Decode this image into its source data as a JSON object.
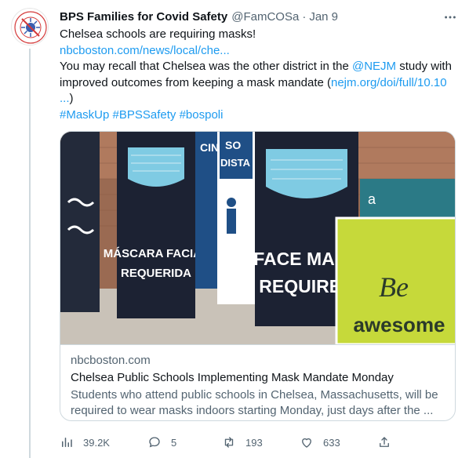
{
  "tweet": {
    "author_name": "BPS Families for Covid Safety",
    "handle": "@FamCOSa",
    "separator": "·",
    "time": "Jan 9",
    "avatar_alt": "FamCOSa logo",
    "lines": {
      "l1": "Chelsea schools are requiring masks!",
      "l2": "nbcboston.com/news/local/che...",
      "l3a": "You may recall that Chelsea was the other district in the ",
      "l3b": "@NEJM",
      "l3c": " study with improved outcomes from keeping a mask mandate (",
      "l3d": "nejm.org/doi/full/10.10 ...",
      "l3e": ")",
      "l4": "#MaskUp #BPSSafety #bospoli"
    }
  },
  "card": {
    "domain": "nbcboston.com",
    "title": "Chelsea Public Schools Implementing Mask Mandate Monday",
    "description": "Students who attend public schools in Chelsea, Massachusetts, will be required to wear masks indoors starting Monday, just days after the ..."
  },
  "image_text": {
    "sign_left_1": "MÁSCARA FACIAL",
    "sign_left_2": "REQUERIDA",
    "sign_main_1": "FACE MASK",
    "sign_main_2": "REQUIRED",
    "sign_right_1": "Be",
    "sign_right_2": "awesome",
    "sign_distance_1": "SO",
    "sign_distance_2": "DISTA",
    "sign_teal_1": "a",
    "sign_blue_1": "CIN"
  },
  "actions": {
    "views": "39.2K",
    "replies": "5",
    "retweets": "193",
    "likes": "633"
  },
  "icons": {
    "views": "analytics-icon",
    "reply": "reply-icon",
    "retweet": "retweet-icon",
    "like": "heart-icon",
    "share": "share-icon",
    "more": "more-icon"
  },
  "colors": {
    "link": "#1d9bf0",
    "muted": "#536471",
    "text": "#0f1419",
    "sign_lime": "#c6d93a",
    "sign_navy": "#1f2a44"
  }
}
